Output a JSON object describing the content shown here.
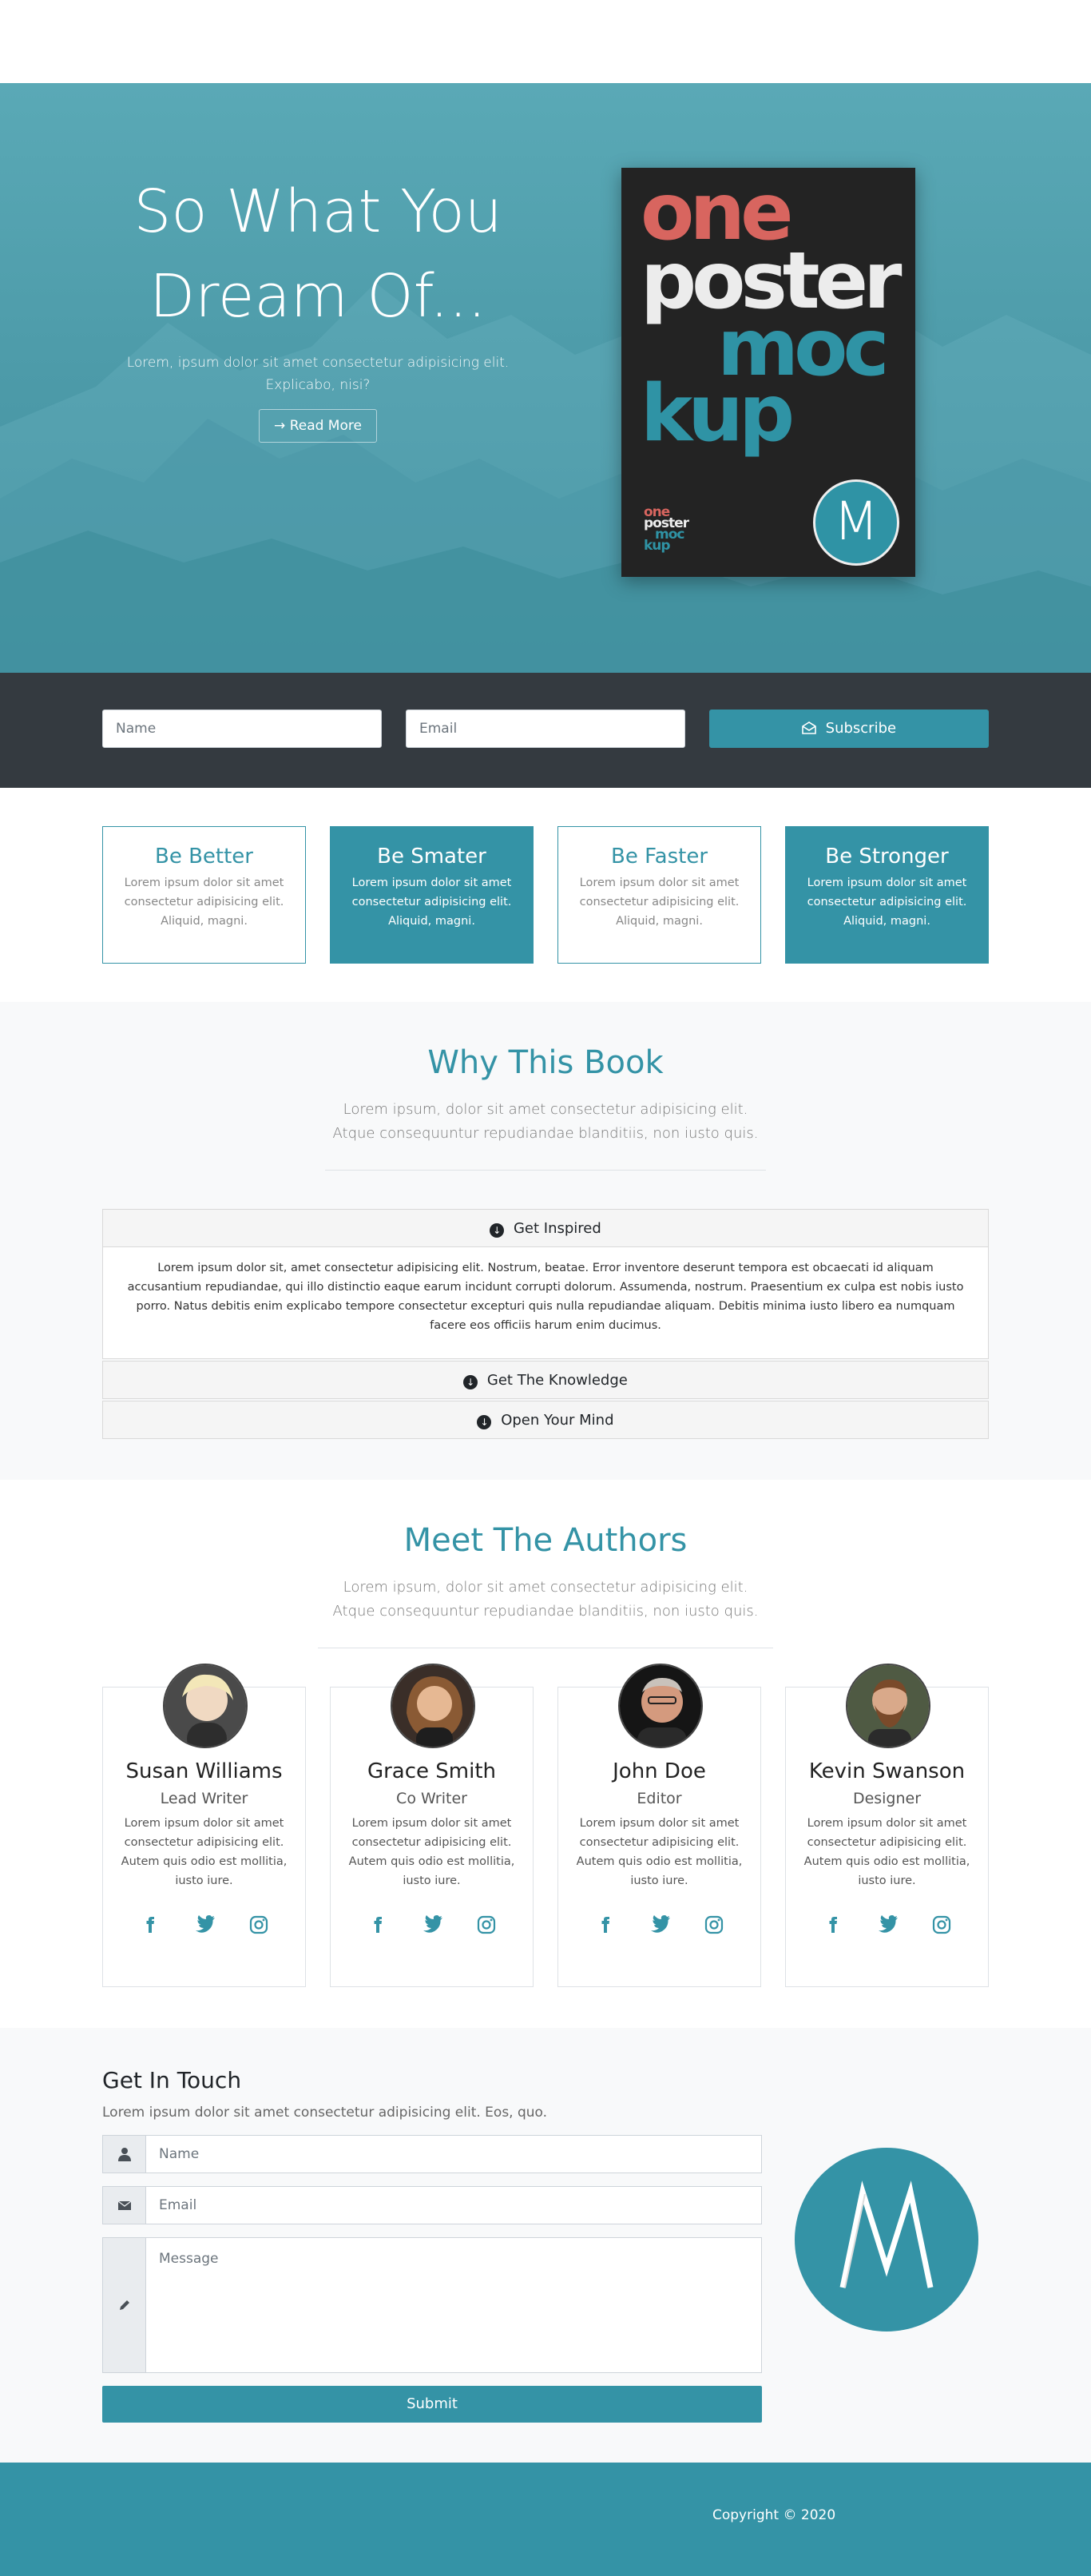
{
  "hero": {
    "title_line1": "So What You",
    "title_line2": "Dream Of...",
    "subtitle": "Lorem, ipsum dolor sit amet consectetur adipisicing elit. Explicabo, nisi?",
    "button_label": "Read More",
    "poster": {
      "line1": "one",
      "line2": "poster",
      "line3": "moc",
      "line4": "kup",
      "small1": "one",
      "small2": "poster",
      "small3": "moc",
      "small4": "kup",
      "logo_letter": "M"
    }
  },
  "subscribe": {
    "name_placeholder": "Name",
    "email_placeholder": "Email",
    "button_label": "Subscribe"
  },
  "features": [
    {
      "title": "Be Better",
      "text": "Lorem ipsum dolor sit amet consectetur adipisicing elit. Aliquid, magni."
    },
    {
      "title": "Be Smater",
      "text": "Lorem ipsum dolor sit amet consectetur adipisicing elit. Aliquid, magni."
    },
    {
      "title": "Be Faster",
      "text": "Lorem ipsum dolor sit amet consectetur adipisicing elit. Aliquid, magni."
    },
    {
      "title": "Be Stronger",
      "text": "Lorem ipsum dolor sit amet consectetur adipisicing elit. Aliquid, magni."
    }
  ],
  "why": {
    "title": "Why This Book",
    "lead": "Lorem ipsum, dolor sit amet consectetur adipisicing elit. Atque consequuntur repudiandae blanditiis, non iusto quis.",
    "accordion": [
      {
        "label": "Get Inspired",
        "body": "Lorem ipsum dolor sit, amet consectetur adipisicing elit. Nostrum, beatae. Error inventore deserunt tempora est obcaecati id aliquam accusantium repudiandae, qui illo distinctio eaque earum incidunt corrupti dolorum. Assumenda, nostrum. Praesentium ex culpa est nobis iusto porro. Natus debitis enim explicabo tempore consectetur excepturi quis nulla repudiandae aliquam. Debitis minima iusto libero ea numquam facere eos officiis harum enim ducimus."
      },
      {
        "label": "Get The Knowledge"
      },
      {
        "label": "Open Your Mind"
      }
    ]
  },
  "authors": {
    "title": "Meet The Authors",
    "lead": "Lorem ipsum, dolor sit amet consectetur adipisicing elit. Atque consequuntur repudiandae blanditiis, non iusto quis.",
    "people": [
      {
        "name": "Susan Williams",
        "role": "Lead Writer",
        "bio": "Lorem ipsum dolor sit amet consectetur adipisicing elit. Autem quis odio est mollitia, iusto iure."
      },
      {
        "name": "Grace Smith",
        "role": "Co Writer",
        "bio": "Lorem ipsum dolor sit amet consectetur adipisicing elit. Autem quis odio est mollitia, iusto iure."
      },
      {
        "name": "John Doe",
        "role": "Editor",
        "bio": "Lorem ipsum dolor sit amet consectetur adipisicing elit. Autem quis odio est mollitia, iusto iure."
      },
      {
        "name": "Kevin Swanson",
        "role": "Designer",
        "bio": "Lorem ipsum dolor sit amet consectetur adipisicing elit. Autem quis odio est mollitia, iusto iure."
      }
    ],
    "social_icons": [
      "facebook-icon",
      "twitter-icon",
      "instagram-icon"
    ]
  },
  "contact": {
    "title": "Get In Touch",
    "lead": "Lorem ipsum dolor sit amet consectetur adipisicing elit. Eos, quo.",
    "name_placeholder": "Name",
    "email_placeholder": "Email",
    "message_placeholder": "Message",
    "submit_label": "Submit"
  },
  "footer": {
    "copyright": "Copyright © 2020"
  },
  "colors": {
    "accent": "#3493a6",
    "dark": "#343a40",
    "light_bg": "#f8f9fa"
  }
}
